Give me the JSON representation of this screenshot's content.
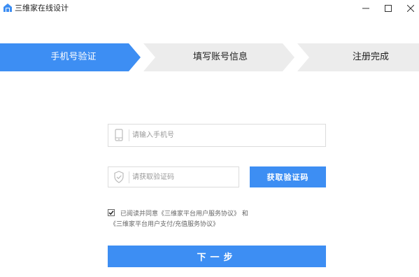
{
  "window": {
    "title": "三维家在线设计",
    "controls": {
      "minimize_icon": "minimize-icon",
      "maximize_icon": "maximize-icon",
      "close_icon": "close-icon"
    }
  },
  "steps": [
    {
      "label": "手机号验证",
      "state": "active"
    },
    {
      "label": "填写账号信息",
      "state": "inactive"
    },
    {
      "label": "注册完成",
      "state": "inactive"
    }
  ],
  "form": {
    "phone": {
      "value": "",
      "placeholder": "请输入手机号",
      "icon": "phone-icon"
    },
    "code": {
      "value": "",
      "placeholder": "请获取验证码",
      "icon": "shield-icon"
    },
    "get_code_label": "获取验证码",
    "agreement": {
      "checked": true,
      "prefix": "已阅读并同意",
      "link1": "《三维家平台用户服务协议》",
      "conjunction": "和",
      "link2": "《三维家平台用户支付/充值服务协议》"
    },
    "next_label": "下一步"
  },
  "colors": {
    "accent": "#3d8ef3",
    "step_active": "#3d8ef3",
    "step_inactive": "#ececec"
  }
}
